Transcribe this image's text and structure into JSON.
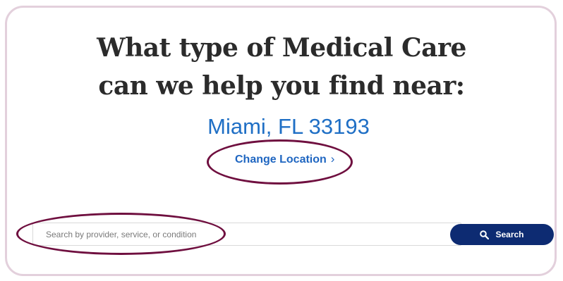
{
  "headline": {
    "line1": "What type of Medical Care",
    "line2": "can we help you find near:"
  },
  "location": {
    "text": "Miami, FL 33193",
    "change_label": "Change Location",
    "change_chevron": "›"
  },
  "search": {
    "placeholder": "Search by provider, service, or condition",
    "value": "",
    "button_label": "Search",
    "button_icon": "search-icon"
  },
  "colors": {
    "headline": "#2b2b2b",
    "location": "#1f6fc5",
    "button_bg": "#0d2b72",
    "annotation_oval": "#6f0f3f",
    "frame_border": "#e3d0dc"
  }
}
